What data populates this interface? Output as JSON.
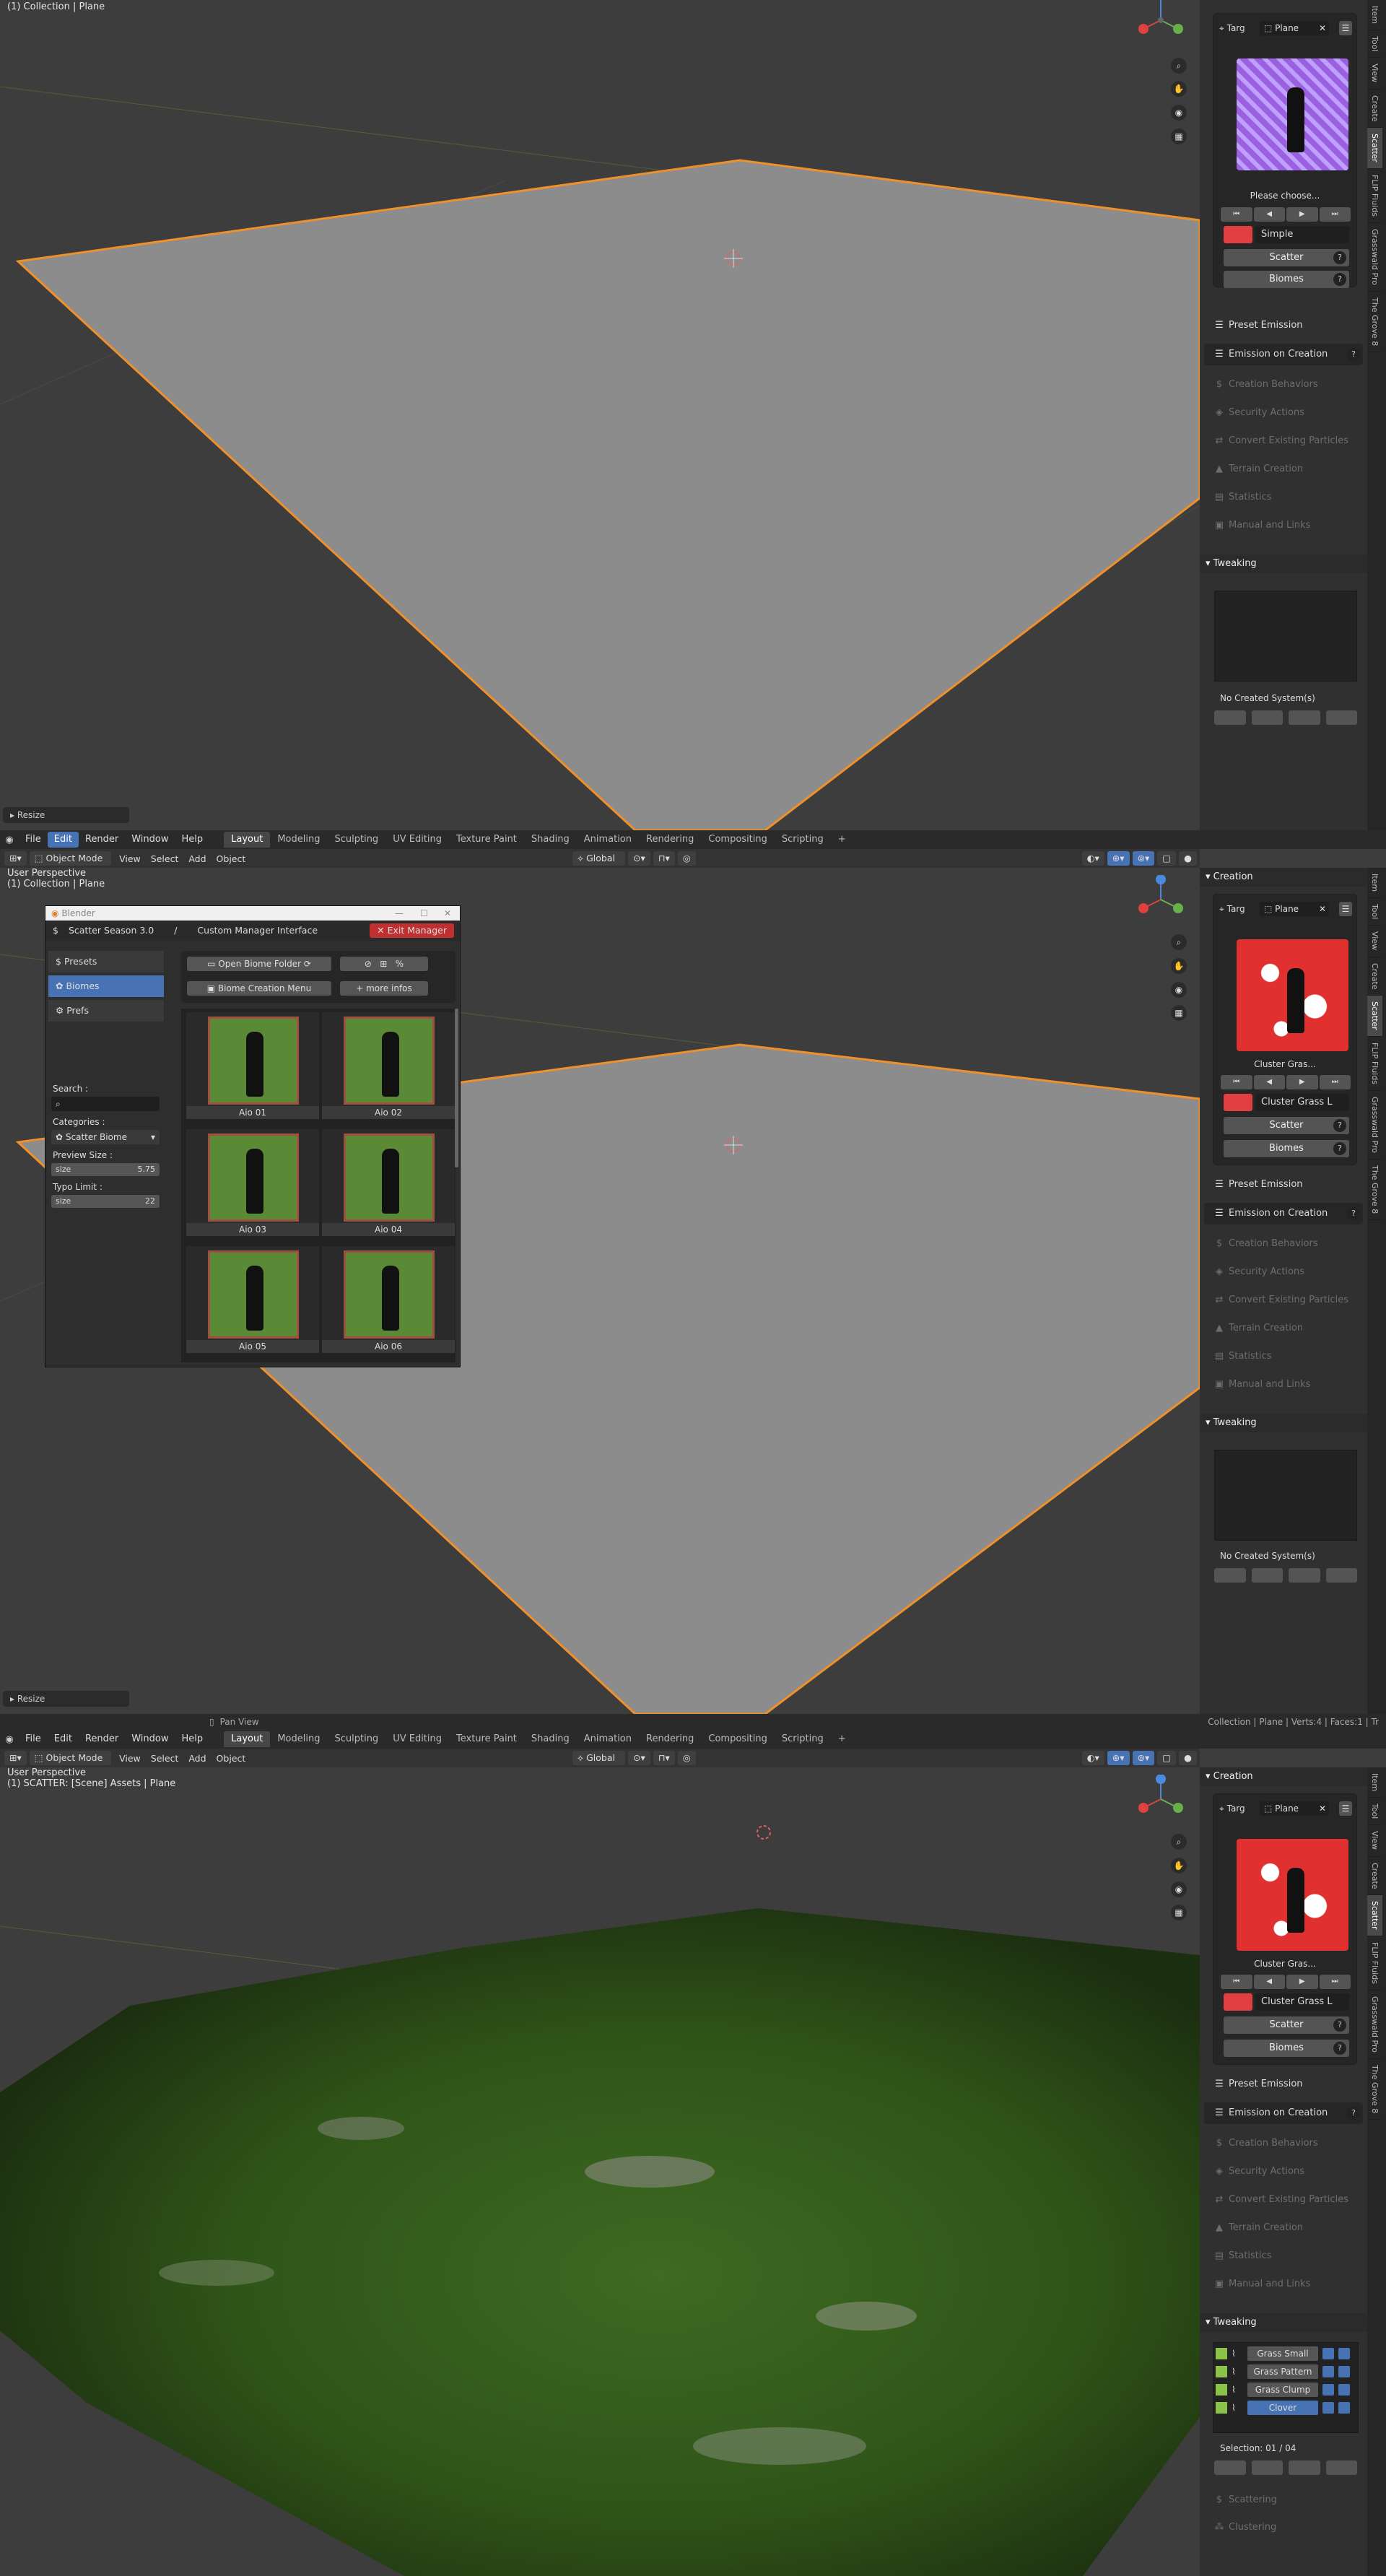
{
  "menu": {
    "items": [
      "File",
      "Edit",
      "Render",
      "Window",
      "Help"
    ],
    "active": "Edit"
  },
  "workspaces": {
    "items": [
      "Layout",
      "Modeling",
      "Sculpting",
      "UV Editing",
      "Texture Paint",
      "Shading",
      "Animation",
      "Rendering",
      "Compositing",
      "Scripting"
    ],
    "active": "Layout",
    "add": "+"
  },
  "header": {
    "mode": "Object Mode",
    "view": "View",
    "select": "Select",
    "add": "Add",
    "object": "Object",
    "orientation": "Global"
  },
  "panels": [
    {
      "viewport": {
        "line1": "",
        "line2": "(1) Collection | Plane",
        "resize": "Resize",
        "state": "plane"
      },
      "side": {
        "target_label": "Targ",
        "target_object": "Plane",
        "preview_caption": "Please choose...",
        "preset_name": "Simple",
        "preview_style": "purple",
        "creation_header": ""
      },
      "tweaking": {
        "empty": "No Created System(s)"
      }
    },
    {
      "viewport": {
        "line1": "User Perspective",
        "line2": "(1) Collection | Plane",
        "resize": "Resize",
        "state": "plane"
      },
      "side": {
        "target_label": "Targ",
        "target_object": "Plane",
        "preview_caption": "Cluster Gras...",
        "preset_name": "Cluster Grass L",
        "preview_style": "red",
        "creation_header": "Creation"
      },
      "tweaking": {
        "empty": "No Created System(s)"
      },
      "status": {
        "left": "Pan View",
        "right": "Collection | Plane | Verts:4 | Faces:1 | Tr"
      }
    },
    {
      "viewport": {
        "line1": "User Perspective",
        "line2": "(1) SCATTER: [Scene] Assets | Plane",
        "resize": "",
        "state": "grass"
      },
      "side": {
        "target_label": "Targ",
        "target_object": "Plane",
        "preview_caption": "Cluster Gras...",
        "preset_name": "Cluster Grass L",
        "preview_style": "red",
        "creation_header": "Creation"
      },
      "tweaking": {
        "systems": [
          "Grass Small",
          "Grass Pattern",
          "Grass Clump",
          "Clover"
        ],
        "selection": "Selection: 01 / 04",
        "extra": [
          "Scattering",
          "Clustering"
        ]
      }
    }
  ],
  "side_common": {
    "scatter": "Scatter",
    "biomes": "Biomes",
    "help": "?",
    "preset_emission": "Preset Emission",
    "emission_on_creation": "Emission on Creation",
    "dim_items": [
      "Creation Behaviors",
      "Security Actions",
      "Convert Existing Particles",
      "Terrain Creation",
      "Statistics",
      "Manual and Links"
    ],
    "tweaking": "Tweaking"
  },
  "tabs": [
    "Item",
    "Tool",
    "View",
    "Create",
    "Scatter",
    "FLIP Fluids",
    "Grasswald Pro",
    "The Grove 8"
  ],
  "tabs_active": "Scatter",
  "manager": {
    "window_title": "Blender",
    "title": "Scatter Season 3.0",
    "separator": "/",
    "subtitle": "Custom Manager Interface",
    "exit": "Exit Manager",
    "nav": [
      "Presets",
      "Biomes",
      "Prefs"
    ],
    "nav_active": "Biomes",
    "open_folder": "Open Biome Folder",
    "creation_menu": "Biome Creation Menu",
    "more_infos": "more infos",
    "search_label": "Search :",
    "categories_label": "Categories :",
    "category_value": "Scatter Biome",
    "preview_size_label": "Preview Size :",
    "preview_size_field": "size",
    "preview_size_value": "5.75",
    "typo_limit_label": "Typo Limit :",
    "typo_limit_field": "size",
    "typo_limit_value": "22",
    "thumbs": [
      "Aio 01",
      "Aio 02",
      "Aio 03",
      "Aio 04",
      "Aio 05",
      "Aio 06"
    ]
  },
  "colors": {
    "accent": "#4772b3",
    "selected_outline": "#f0902a",
    "exit": "#c03030",
    "swatch": "#e04040",
    "grass": "#4a6a2a"
  }
}
